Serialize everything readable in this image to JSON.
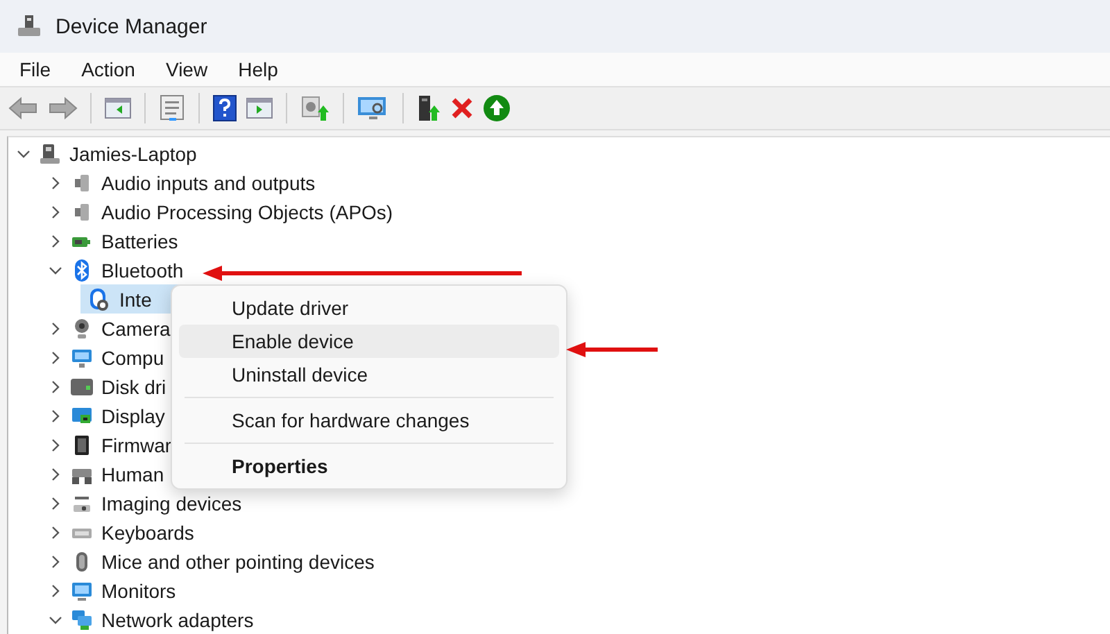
{
  "window": {
    "title": "Device Manager"
  },
  "menu_bar": [
    "File",
    "Action",
    "View",
    "Help"
  ],
  "tree": [
    {
      "label": "Jamies-Laptop",
      "expanded": true,
      "selected": false,
      "children": [
        {
          "label": "Audio inputs and outputs",
          "expanded": false,
          "selected": false
        },
        {
          "label": "Audio Processing Objects (APOs)",
          "expanded": false,
          "selected": false
        },
        {
          "label": "Batteries",
          "expanded": false,
          "selected": false
        },
        {
          "label": "Bluetooth",
          "expanded": true,
          "selected": false,
          "children": [
            {
              "label": "Inte",
              "selected": true
            }
          ]
        },
        {
          "label": "Camera",
          "expanded": false,
          "selected": false
        },
        {
          "label": "Compu",
          "expanded": false,
          "selected": false
        },
        {
          "label": "Disk dri",
          "expanded": false,
          "selected": false
        },
        {
          "label": "Display",
          "expanded": false,
          "selected": false
        },
        {
          "label": "Firmwar",
          "expanded": false,
          "selected": false
        },
        {
          "label": "Human",
          "expanded": false,
          "selected": false
        },
        {
          "label": "Imaging devices",
          "expanded": false,
          "selected": false
        },
        {
          "label": "Keyboards",
          "expanded": false,
          "selected": false
        },
        {
          "label": "Mice and other pointing devices",
          "expanded": false,
          "selected": false
        },
        {
          "label": "Monitors",
          "expanded": false,
          "selected": false
        },
        {
          "label": "Network adapters",
          "expanded": true,
          "selected": false
        }
      ]
    }
  ],
  "context_menu": [
    {
      "kind": "item",
      "label": "Update driver",
      "selected": false,
      "default": false
    },
    {
      "kind": "item",
      "label": "Enable device",
      "selected": true,
      "default": false
    },
    {
      "kind": "item",
      "label": "Uninstall device",
      "selected": false,
      "default": false
    },
    {
      "kind": "separator"
    },
    {
      "kind": "item",
      "label": "Scan for hardware changes",
      "selected": false,
      "default": false
    },
    {
      "kind": "separator"
    },
    {
      "kind": "item",
      "label": "Properties",
      "selected": false,
      "default": true
    }
  ]
}
